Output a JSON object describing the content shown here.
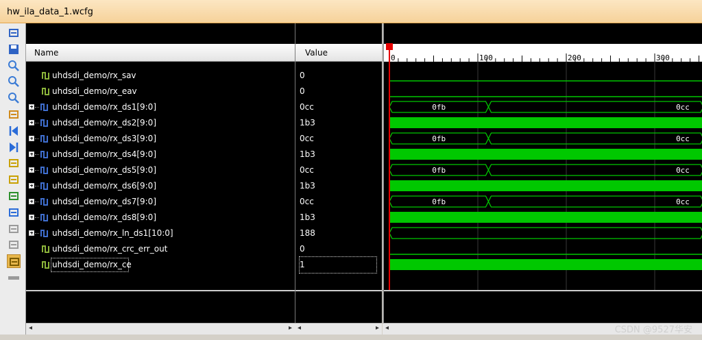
{
  "window": {
    "title": "hw_ila_data_1.wcfg"
  },
  "toolbar": {
    "icons": [
      "go-to-end-icon",
      "save-icon",
      "zoom-in-icon",
      "zoom-out-icon",
      "zoom-fit-icon",
      "cursor-icon",
      "first-edge-icon",
      "last-edge-icon",
      "previous-transition-icon",
      "next-transition-icon",
      "add-marker-icon",
      "previous-marker-icon",
      "next-marker-icon",
      "swap-cursors-icon",
      "snap-icon",
      "bus-icon"
    ]
  },
  "columns": {
    "name": "Name",
    "value": "Value"
  },
  "signals": [
    {
      "name": "uhdsdi_demo/rx_sav",
      "value": "0",
      "bus": false
    },
    {
      "name": "uhdsdi_demo/rx_eav",
      "value": "0",
      "bus": false
    },
    {
      "name": "uhdsdi_demo/rx_ds1[9:0]",
      "value": "0cc",
      "bus": true
    },
    {
      "name": "uhdsdi_demo/rx_ds2[9:0]",
      "value": "1b3",
      "bus": true
    },
    {
      "name": "uhdsdi_demo/rx_ds3[9:0]",
      "value": "0cc",
      "bus": true
    },
    {
      "name": "uhdsdi_demo/rx_ds4[9:0]",
      "value": "1b3",
      "bus": true
    },
    {
      "name": "uhdsdi_demo/rx_ds5[9:0]",
      "value": "0cc",
      "bus": true
    },
    {
      "name": "uhdsdi_demo/rx_ds6[9:0]",
      "value": "1b3",
      "bus": true
    },
    {
      "name": "uhdsdi_demo/rx_ds7[9:0]",
      "value": "0cc",
      "bus": true
    },
    {
      "name": "uhdsdi_demo/rx_ds8[9:0]",
      "value": "1b3",
      "bus": true
    },
    {
      "name": "uhdsdi_demo/rx_ln_ds1[10:0]",
      "value": "188",
      "bus": true
    },
    {
      "name": "uhdsdi_demo/rx_crc_err_out",
      "value": "0",
      "bus": false
    },
    {
      "name": "uhdsdi_demo/rx_ce",
      "value": "1",
      "bus": false,
      "selected": true
    }
  ],
  "timeline": {
    "ticks": [
      0,
      100,
      200,
      300
    ],
    "start": 0,
    "end": 355,
    "cursor_at": 0
  },
  "waveforms": [
    {
      "kind": "low"
    },
    {
      "kind": "low"
    },
    {
      "kind": "bus",
      "segments": [
        {
          "from": 0,
          "to": 112,
          "label": "0fb"
        },
        {
          "from": 112,
          "to": 355,
          "label": "0cc"
        }
      ]
    },
    {
      "kind": "solid"
    },
    {
      "kind": "bus",
      "segments": [
        {
          "from": 0,
          "to": 112,
          "label": "0fb"
        },
        {
          "from": 112,
          "to": 355,
          "label": "0cc"
        }
      ]
    },
    {
      "kind": "solid"
    },
    {
      "kind": "bus",
      "segments": [
        {
          "from": 0,
          "to": 112,
          "label": "0fb"
        },
        {
          "from": 112,
          "to": 355,
          "label": "0cc"
        }
      ]
    },
    {
      "kind": "solid"
    },
    {
      "kind": "bus",
      "segments": [
        {
          "from": 0,
          "to": 112,
          "label": "0fb"
        },
        {
          "from": 112,
          "to": 355,
          "label": "0cc"
        }
      ]
    },
    {
      "kind": "solid"
    },
    {
      "kind": "bus",
      "segments": [
        {
          "from": 0,
          "to": 355,
          "label": ""
        }
      ]
    },
    {
      "kind": "low"
    },
    {
      "kind": "solid"
    }
  ],
  "colors": {
    "wave": "#00c800",
    "cursor": "#e60000",
    "grid": "#3a3a3a"
  },
  "watermark": "CSDN @9527华安"
}
